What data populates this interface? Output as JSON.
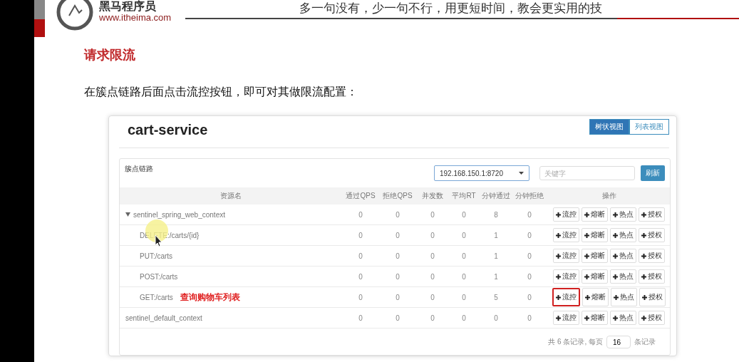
{
  "header": {
    "logo_text": "黑马程序员",
    "logo_url": "www.itheima.com",
    "slogan": "多一句没有，少一句不行，用更短时间，教会更实用的技"
  },
  "slide": {
    "title": "请求限流",
    "body": "在簇点链路后面点击流控按钮，即可对其做限流配置："
  },
  "app": {
    "title": "cart-service",
    "view_tabs": [
      {
        "label": "树状视图",
        "selected": true
      },
      {
        "label": "列表视图",
        "selected": false
      }
    ],
    "panel_title": "簇点链路",
    "machine_select": {
      "value": "192.168.150.1:8720"
    },
    "search": {
      "placeholder": "关键字"
    },
    "refresh_button": "刷新",
    "columns": [
      "资源名",
      "通过QPS",
      "拒绝QPS",
      "并发数",
      "平均RT",
      "分钟通过",
      "分钟拒绝",
      "操作"
    ],
    "rows": [
      {
        "name": "sentinel_spring_web_context",
        "expanded": true,
        "values": [
          "0",
          "0",
          "0",
          "0",
          "8",
          "0"
        ],
        "actions": [
          {
            "label": "流控",
            "highlighted": false
          },
          {
            "label": "熔断",
            "highlighted": false
          },
          {
            "label": "热点",
            "highlighted": false
          },
          {
            "label": "授权",
            "highlighted": false
          }
        ],
        "children": [
          {
            "name": "DELETE:/carts/{id}",
            "values": [
              "0",
              "0",
              "0",
              "0",
              "1",
              "0"
            ],
            "actions": [
              {
                "label": "流控",
                "highlighted": false
              },
              {
                "label": "熔断",
                "highlighted": false
              },
              {
                "label": "热点",
                "highlighted": false
              },
              {
                "label": "授权",
                "highlighted": false
              }
            ]
          },
          {
            "name": "PUT:/carts",
            "values": [
              "0",
              "0",
              "0",
              "0",
              "1",
              "0"
            ],
            "actions": [
              {
                "label": "流控",
                "highlighted": false
              },
              {
                "label": "熔断",
                "highlighted": false
              },
              {
                "label": "热点",
                "highlighted": false
              },
              {
                "label": "授权",
                "highlighted": false
              }
            ]
          },
          {
            "name": "POST:/carts",
            "values": [
              "0",
              "0",
              "0",
              "0",
              "1",
              "0"
            ],
            "actions": [
              {
                "label": "流控",
                "highlighted": false
              },
              {
                "label": "熔断",
                "highlighted": false
              },
              {
                "label": "热点",
                "highlighted": false
              },
              {
                "label": "授权",
                "highlighted": false
              }
            ]
          },
          {
            "name": "GET:/carts",
            "note": "查询购物车列表",
            "values": [
              "0",
              "0",
              "0",
              "0",
              "5",
              "0"
            ],
            "actions": [
              {
                "label": "流控",
                "highlighted": true
              },
              {
                "label": "熔断",
                "highlighted": false
              },
              {
                "label": "热点",
                "highlighted": false
              },
              {
                "label": "授权",
                "highlighted": false
              }
            ]
          }
        ]
      },
      {
        "name": "sentinel_default_context",
        "values": [
          "0",
          "0",
          "0",
          "0",
          "0",
          "0"
        ],
        "actions": [
          {
            "label": "流控",
            "highlighted": false
          },
          {
            "label": "熔断",
            "highlighted": false
          },
          {
            "label": "热点",
            "highlighted": false
          },
          {
            "label": "授权",
            "highlighted": false
          }
        ]
      }
    ],
    "pagination": {
      "prefix": "共 6 条记录, 每页",
      "page_size": "16",
      "suffix": "条记录"
    }
  }
}
